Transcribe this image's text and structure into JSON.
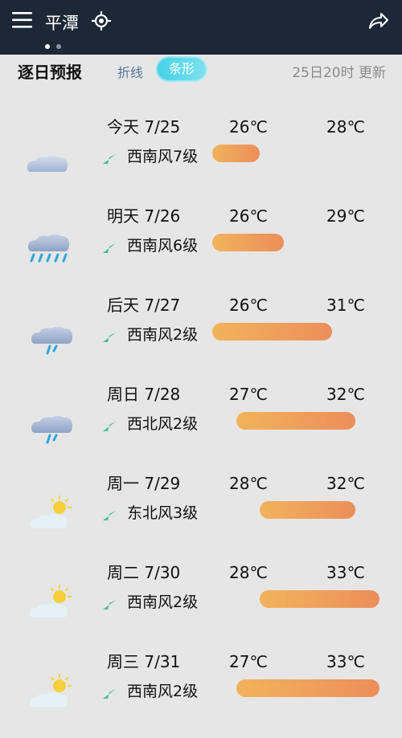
{
  "header": {
    "city": "平潭",
    "menu_icon": "menu-icon",
    "location_icon": "location-crosshair-icon",
    "share_icon": "share-icon",
    "page_dots": 2,
    "active_dot": 0
  },
  "section": {
    "title": "逐日预报",
    "tab_line": "折线",
    "tab_bar": "条形",
    "selected_tab": "条形",
    "update_time": "25日20时 更新"
  },
  "days": [
    {
      "label": "今天 7/25",
      "weather_icon": "cloudy-icon",
      "wind": "西南风7级",
      "low": "26℃",
      "high": "28℃",
      "low_value": 26,
      "high_value": 28
    },
    {
      "label": "明天 7/26",
      "weather_icon": "heavy-rain-icon",
      "wind": "西南风6级",
      "low": "26℃",
      "high": "29℃",
      "low_value": 26,
      "high_value": 29
    },
    {
      "label": "后天 7/27",
      "weather_icon": "light-rain-icon",
      "wind": "西南风2级",
      "low": "26℃",
      "high": "31℃",
      "low_value": 26,
      "high_value": 31
    },
    {
      "label": "周日 7/28",
      "weather_icon": "light-rain-icon",
      "wind": "西北风2级",
      "low": "27℃",
      "high": "32℃",
      "low_value": 27,
      "high_value": 32
    },
    {
      "label": "周一 7/29",
      "weather_icon": "partly-cloudy-icon",
      "wind": "东北风3级",
      "low": "28℃",
      "high": "32℃",
      "low_value": 28,
      "high_value": 32
    },
    {
      "label": "周二 7/30",
      "weather_icon": "partly-cloudy-icon",
      "wind": "西南风2级",
      "low": "28℃",
      "high": "33℃",
      "low_value": 28,
      "high_value": 33
    },
    {
      "label": "周三 7/31",
      "weather_icon": "partly-cloudy-icon",
      "wind": "西南风2级",
      "low": "27℃",
      "high": "33℃",
      "low_value": 27,
      "high_value": 33
    }
  ],
  "temp_scale": {
    "min": 26,
    "max": 33
  },
  "colors": {
    "header_bg": "#1c2737",
    "page_bg": "#e6e6e6",
    "bar_start": "#f2b35c",
    "bar_end": "#ec8e5a",
    "tab_active": "#44d2e5",
    "wind_arrow": "#3fbf8f"
  }
}
